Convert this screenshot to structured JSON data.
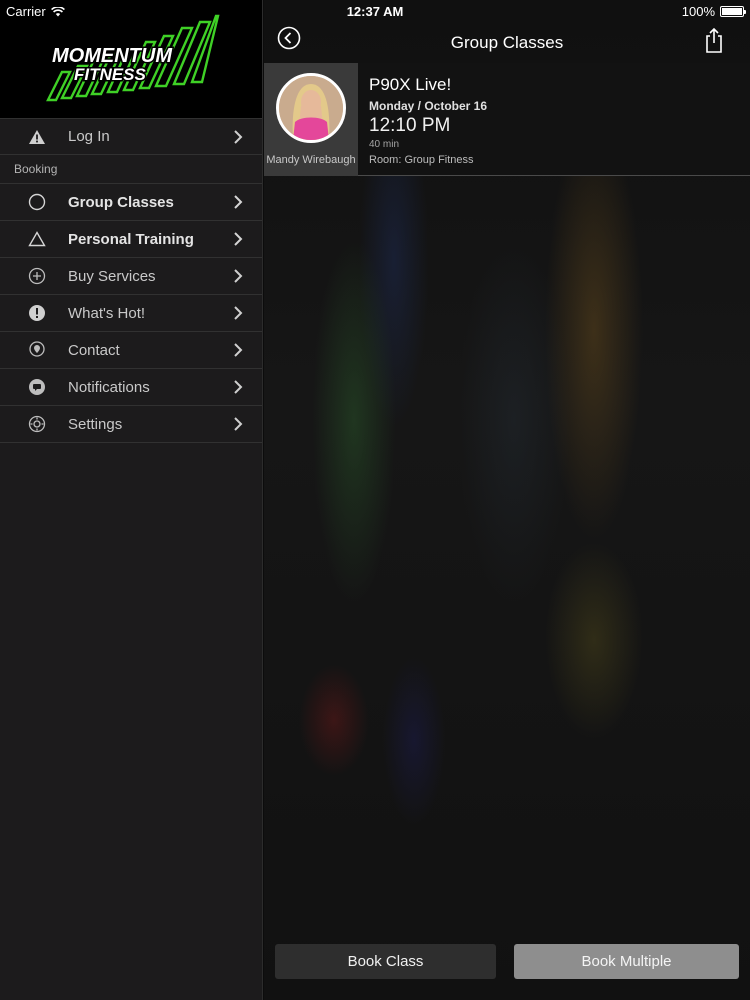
{
  "status_bar": {
    "carrier": "Carrier",
    "time": "12:37 AM",
    "battery": "100%"
  },
  "sidebar": {
    "logo_alt": "Momentum Fitness",
    "logo_text_top": "MOMENTUM",
    "logo_text_bottom": "FITNESS",
    "login_label": "Log In",
    "section_header": "Booking",
    "items": [
      {
        "label": "Group Classes",
        "icon": "circle-icon"
      },
      {
        "label": "Personal Training",
        "icon": "triangle-icon"
      },
      {
        "label": "Buy Services",
        "icon": "plus-circle-icon"
      },
      {
        "label": "What's Hot!",
        "icon": "exclamation-circle-icon"
      },
      {
        "label": "Contact",
        "icon": "location-pin-icon"
      },
      {
        "label": "Notifications",
        "icon": "chat-bubble-icon"
      },
      {
        "label": "Settings",
        "icon": "gear-icon"
      }
    ]
  },
  "main": {
    "title": "Group Classes",
    "class": {
      "name": "P90X Live!",
      "date": "Monday / October 16",
      "time": "12:10 PM",
      "duration": "40 min",
      "room": "Room: Group Fitness",
      "instructor": "Mandy Wirebaugh"
    },
    "book_class_label": "Book Class",
    "book_multiple_label": "Book Multiple"
  },
  "colors": {
    "logo_green": "#3fd126",
    "sidebar_bg": "#1c1b1c",
    "button_light": "#8e8e8e"
  }
}
